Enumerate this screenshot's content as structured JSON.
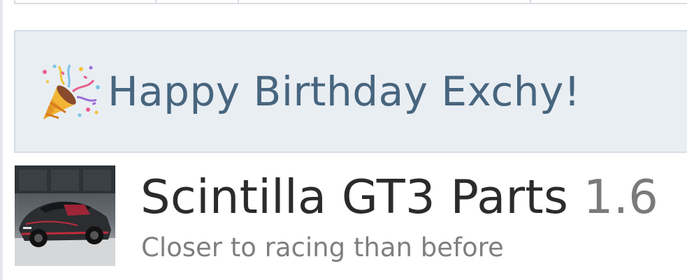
{
  "banner": {
    "icon": "party-popper-icon",
    "text": "Happy Birthday Exchy!",
    "text_color": "#47657e",
    "background": "#e9eef3"
  },
  "resource": {
    "thumbnail_icon": "race-car-thumbnail",
    "title": "Scintilla GT3 Parts",
    "version": "1.6",
    "tagline": "Closer to racing than before"
  }
}
